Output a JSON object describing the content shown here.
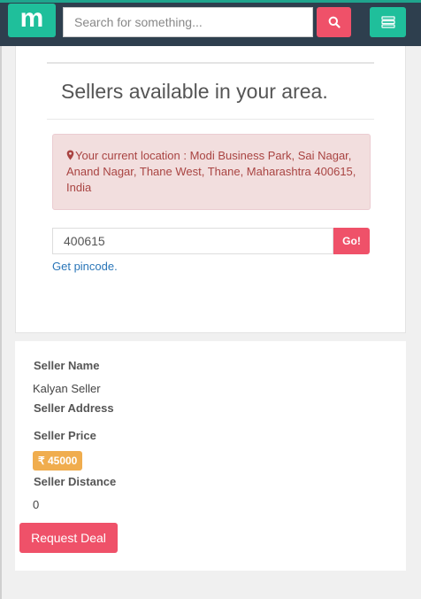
{
  "navbar": {
    "logo_text": "m",
    "search_placeholder": "Search for something...",
    "search_icon": "search-icon",
    "menu_icon": "menu-list-icon",
    "accent_color": "#1fbf9b",
    "button_color": "#ef5169"
  },
  "location": {
    "heading": "Sellers available in your area.",
    "alert_icon": "map-marker-icon",
    "alert_text": "Your current location : Modi Business Park, Sai Nagar, Anand Nagar, Thane West, Thane, Maharashtra 400615, India",
    "pincode_value": "400615",
    "go_label": "Go!",
    "get_pincode_link": "Get pincode."
  },
  "seller": {
    "name_label": "Seller Name",
    "name_value": "Kalyan Seller",
    "address_label": "Seller Address",
    "price_label": "Seller Price",
    "price_value": "₹ 45000",
    "distance_label": "Seller Distance",
    "distance_value": "0",
    "request_button": "Request Deal"
  }
}
